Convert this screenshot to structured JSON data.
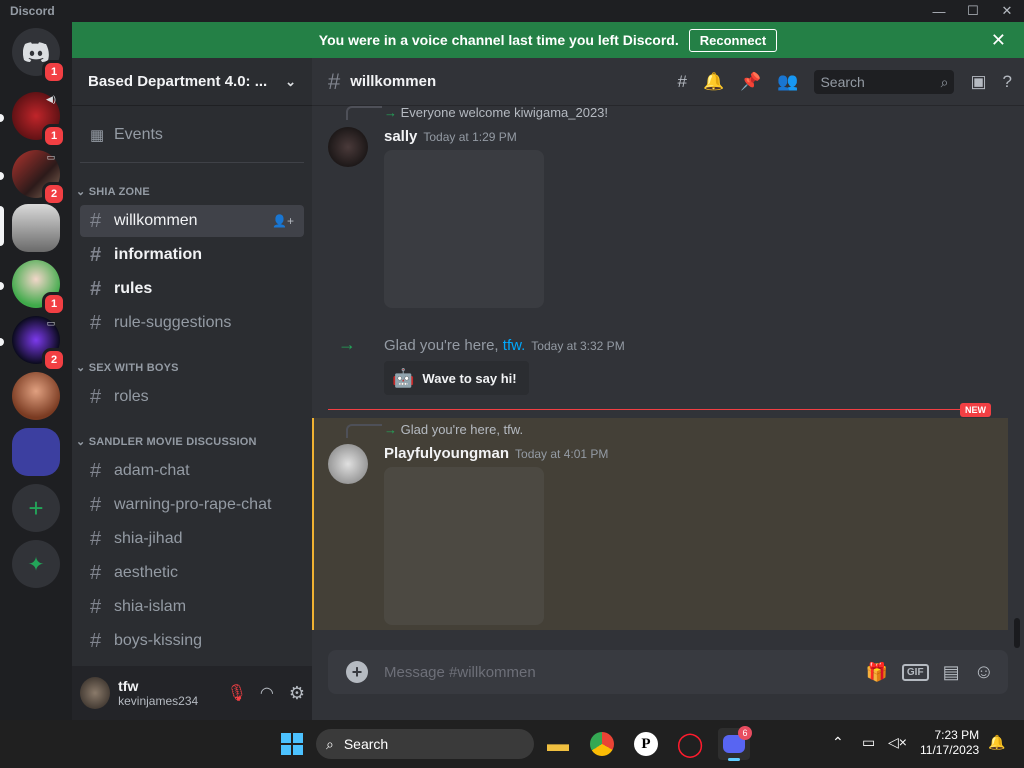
{
  "app": {
    "title": "Discord"
  },
  "window_controls": {
    "minimize": "—",
    "maximize": "☐",
    "close": "✕"
  },
  "banner": {
    "text": "You were in a voice channel last time you left Discord.",
    "button": "Reconnect",
    "color": "#248046"
  },
  "server": {
    "name": "Based Department 4.0: ..."
  },
  "guild_badges": [
    "1",
    "1",
    "2",
    "1",
    "2"
  ],
  "sidebar": {
    "events": "Events",
    "categories": [
      "SHIA ZONE",
      "SEX WITH BOYS",
      "SANDLER MOVIE DISCUSSION"
    ],
    "channels": [
      "willkommen",
      "information",
      "rules",
      "rule-suggestions",
      "roles",
      "adam-chat",
      "warning-pro-rape-chat",
      "shia-jihad",
      "aesthetic",
      "shia-islam",
      "boys-kissing"
    ]
  },
  "user": {
    "name": "tfw",
    "tag": "kevinjames234"
  },
  "channel": {
    "name": "willkommen",
    "search_placeholder": "Search"
  },
  "messages": [
    {
      "reply": "Everyone welcome kiwigama_2023!",
      "author": "sally",
      "time": "Today at 1:29 PM"
    },
    {
      "system_text": "Glad you're here,",
      "mention": "tfw.",
      "time": "Today at 3:32 PM",
      "wave_button": "Wave to say hi!"
    },
    {
      "reply": "Glad you're here, tfw.",
      "author": "Playfulyoungman",
      "time": "Today at 4:01 PM"
    }
  ],
  "new_label": "NEW",
  "composer": {
    "placeholder": "Message #willkommen",
    "gif": "GIF"
  },
  "taskbar": {
    "search": "Search",
    "time": "7:23 PM",
    "date": "11/17/2023",
    "discord_badge": "6"
  },
  "colors": {
    "accent": "#5865f2",
    "online": "#23a559",
    "mention": "#00a8fc",
    "new": "#f23f43"
  }
}
